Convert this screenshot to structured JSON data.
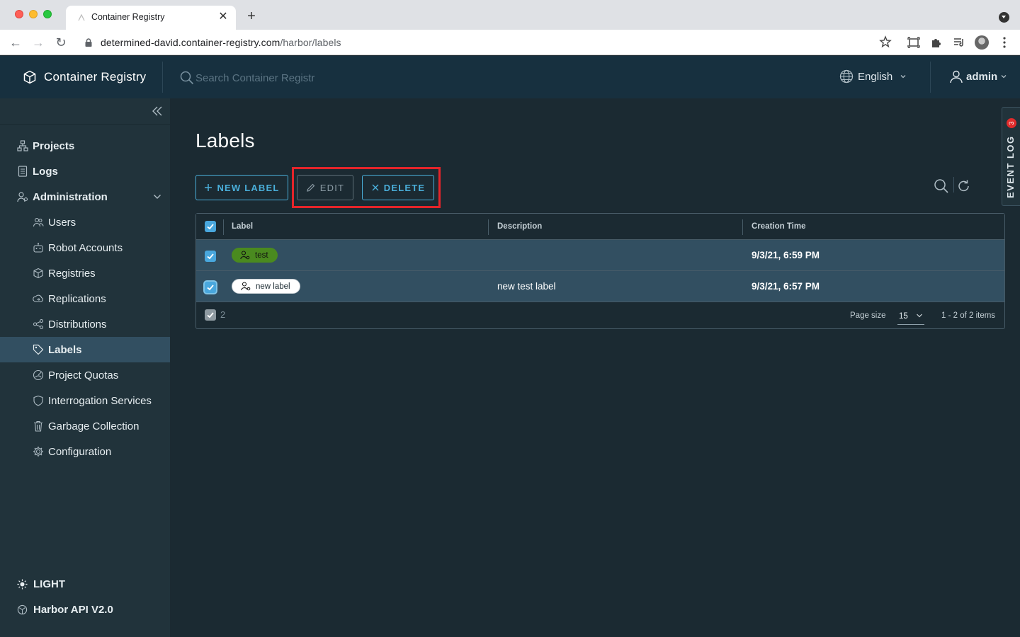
{
  "browser": {
    "tab_title": "Container Registry",
    "url_host": "determined-david.container-registry.com",
    "url_path": "/harbor/labels"
  },
  "header": {
    "brand": "Container Registry",
    "search_placeholder": "Search Container Registr",
    "language": "English",
    "user": "admin"
  },
  "sidebar": {
    "items": [
      {
        "label": "Projects",
        "icon": "projects-icon"
      },
      {
        "label": "Logs",
        "icon": "logs-icon"
      },
      {
        "label": "Administration",
        "icon": "administration-icon"
      },
      {
        "label": "Users",
        "icon": "users-icon"
      },
      {
        "label": "Robot Accounts",
        "icon": "robot-icon"
      },
      {
        "label": "Registries",
        "icon": "registries-icon"
      },
      {
        "label": "Replications",
        "icon": "replications-icon"
      },
      {
        "label": "Distributions",
        "icon": "distributions-icon"
      },
      {
        "label": "Labels",
        "icon": "tag-icon",
        "active": true
      },
      {
        "label": "Project Quotas",
        "icon": "quota-icon"
      },
      {
        "label": "Interrogation Services",
        "icon": "shield-icon"
      },
      {
        "label": "Garbage Collection",
        "icon": "trash-icon"
      },
      {
        "label": "Configuration",
        "icon": "gear-icon"
      }
    ],
    "theme_toggle": "LIGHT",
    "api_link": "Harbor API V2.0"
  },
  "main": {
    "title": "Labels",
    "buttons": {
      "new_label": "NEW LABEL",
      "edit": "EDIT",
      "delete": "DELETE"
    },
    "event_log": {
      "label": "EVENT LOG",
      "count": "3"
    },
    "table": {
      "columns": [
        "Label",
        "Description",
        "Creation Time"
      ],
      "rows": [
        {
          "label": "test",
          "color": "#4a8a1f",
          "description": "",
          "created": "9/3/21, 6:59 PM"
        },
        {
          "label": "new label",
          "color": "#ffffff",
          "description": "new test label",
          "created": "9/3/21, 6:57 PM"
        }
      ],
      "selected_count": "2",
      "page_size_label": "Page size",
      "page_size": "15",
      "pagination": "1 - 2 of 2 items"
    }
  },
  "colors": {
    "accent": "#4aaed9",
    "header_bg": "#17303f",
    "sidebar_bg": "#21333b",
    "main_bg": "#1b2a32",
    "highlight": "#e5242a"
  }
}
